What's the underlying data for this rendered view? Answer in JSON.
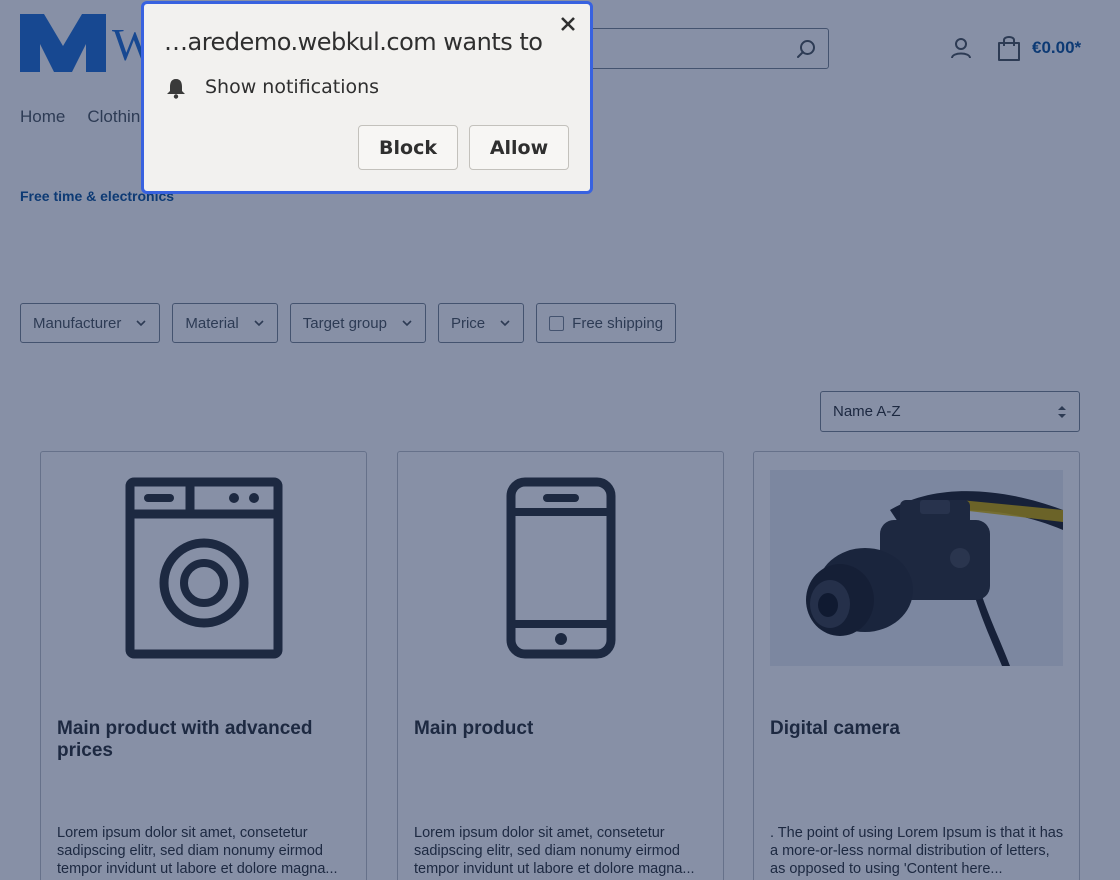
{
  "header": {
    "logo_text": "W",
    "cart_total": "€0.00*"
  },
  "nav": {
    "items": [
      "Home",
      "Clothing"
    ]
  },
  "breadcrumb": "Free time & electronics",
  "filters": {
    "manufacturer": "Manufacturer",
    "material": "Material",
    "target_group": "Target group",
    "price": "Price",
    "free_shipping": "Free shipping"
  },
  "sort": {
    "selected": "Name A-Z"
  },
  "products": [
    {
      "title": "Main product with advanced prices",
      "description": "Lorem ipsum dolor sit amet, consetetur sadipscing elitr, sed diam nonumy eirmod tempor invidunt ut labore et dolore magna..."
    },
    {
      "title": "Main product",
      "description": "Lorem ipsum dolor sit amet, consetetur sadipscing elitr, sed diam nonumy eirmod tempor invidunt ut labore et dolore magna..."
    },
    {
      "title": "Digital camera",
      "description": ". The point of using Lorem Ipsum is that it has a more-or-less normal distribution of letters, as opposed to using 'Content here..."
    }
  ],
  "prompt": {
    "title": "…aredemo.webkul.com wants to",
    "permission": "Show notifications",
    "block_label": "Block",
    "allow_label": "Allow"
  },
  "colors": {
    "accent": "#0b539b",
    "overlay": "#10224d",
    "prompt_border": "#3862e0"
  }
}
